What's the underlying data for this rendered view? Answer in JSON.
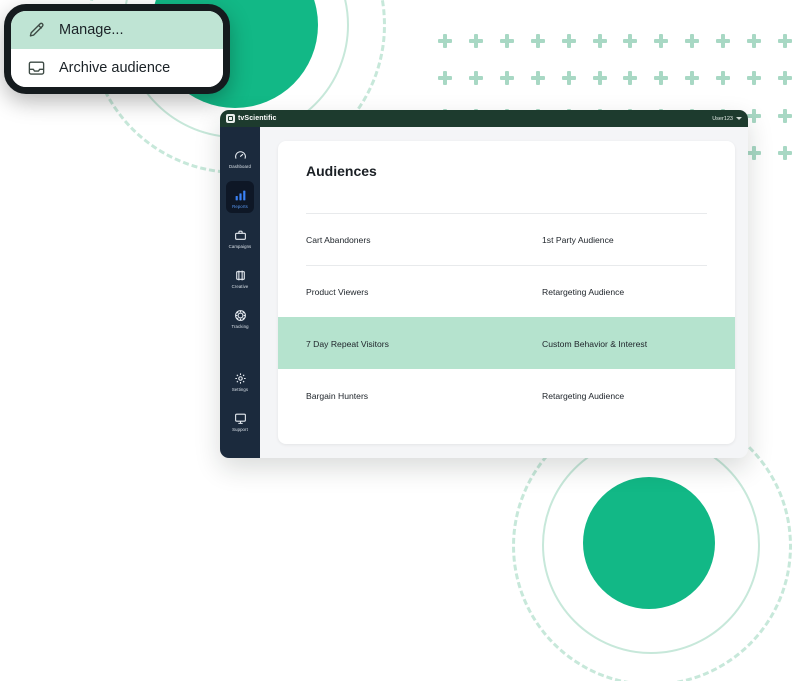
{
  "context_menu": {
    "items": [
      {
        "label": "Manage...",
        "icon": "pencil-icon",
        "selected": true
      },
      {
        "label": "Archive audience",
        "icon": "archive-icon",
        "selected": false
      }
    ]
  },
  "app": {
    "topbar": {
      "brand": "tvScientific",
      "user": "User123",
      "user_menu_icon": "chevron-down-icon"
    },
    "sidebar": {
      "items": [
        {
          "label": "Dashboard",
          "icon": "gauge-icon",
          "active": false
        },
        {
          "label": "Reports",
          "icon": "bar-chart-icon",
          "active": true
        },
        {
          "label": "Campaigns",
          "icon": "briefcase-icon",
          "active": false
        },
        {
          "label": "Creative",
          "icon": "crop-icon",
          "active": false
        },
        {
          "label": "Tracking",
          "icon": "target-icon",
          "active": false
        }
      ],
      "bottom_items": [
        {
          "label": "Settings",
          "icon": "gear-icon",
          "active": false
        },
        {
          "label": "Support",
          "icon": "monitor-icon",
          "active": false
        }
      ]
    },
    "page": {
      "title": "Audiences",
      "rows": [
        {
          "name": "Cart Abandoners",
          "type": "1st Party Audience",
          "highlighted": false
        },
        {
          "name": "Product Viewers",
          "type": "Retargeting Audience",
          "highlighted": false
        },
        {
          "name": "7 Day Repeat Visitors",
          "type": "Custom Behavior & Interest",
          "highlighted": true
        },
        {
          "name": "Bargain Hunters",
          "type": "Retargeting Audience",
          "highlighted": false
        }
      ]
    }
  },
  "decoration": {
    "accent_green": "#12b886",
    "ring_green": "#c7e8da",
    "plus_green": "#a8d8c4",
    "highlight_green": "#b5e3ce",
    "topbar_dark_green": "#1d3b2e",
    "sidebar_navy": "#1b2a3d"
  }
}
